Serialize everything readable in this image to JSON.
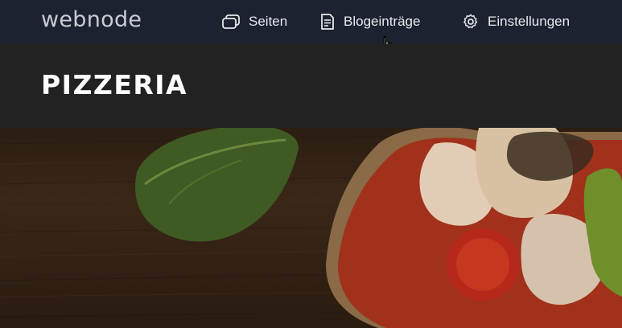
{
  "app": {
    "logo_text": "webnode"
  },
  "nav": {
    "items": [
      {
        "id": "seiten",
        "label": "Seiten",
        "icon": "pages-icon"
      },
      {
        "id": "blog",
        "label": "Blogeinträge",
        "icon": "blog-entries-icon"
      },
      {
        "id": "settings",
        "label": "Einstellungen",
        "icon": "gear-icon"
      }
    ]
  },
  "site": {
    "title": "PIZZERIA"
  },
  "hero": {
    "image": "pizza-on-wooden-board-image"
  },
  "colors": {
    "topbar_bg": "#1d2230",
    "header_bg": "#222222",
    "nav_text": "#e6e8ec",
    "logo_text": "#c9ccd3"
  }
}
